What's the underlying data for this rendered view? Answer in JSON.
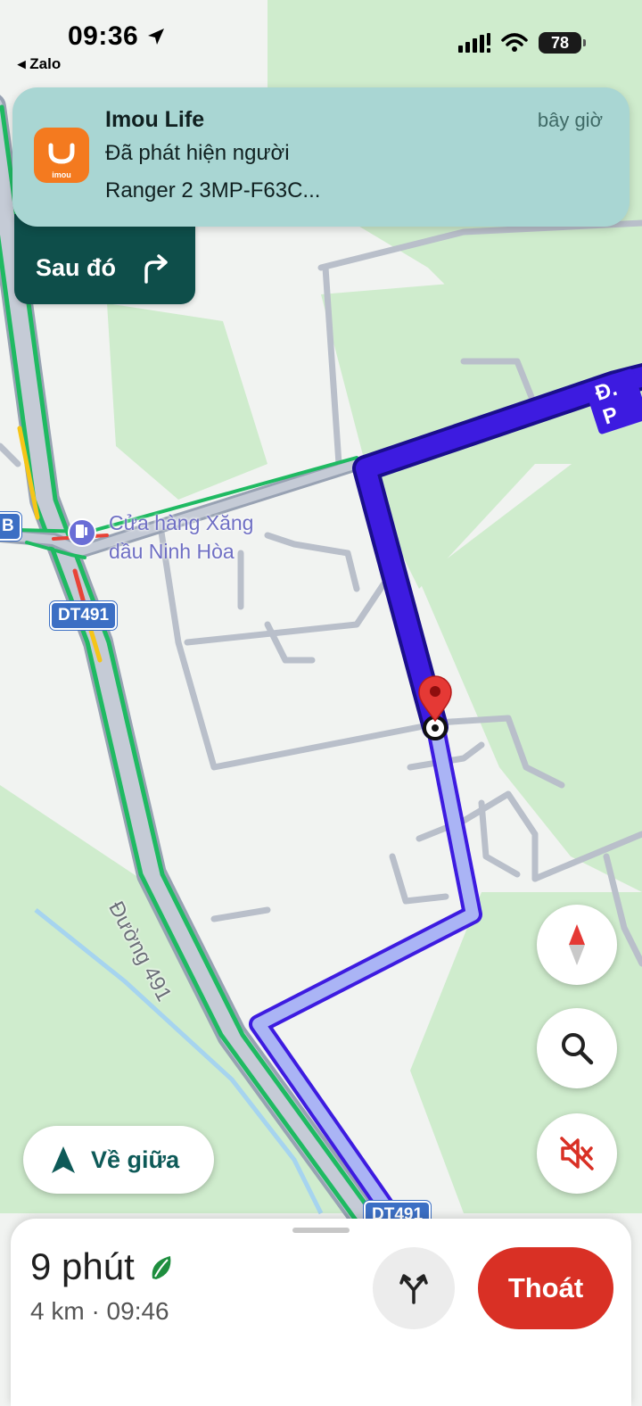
{
  "status_bar": {
    "time": "09:36",
    "back_app": "◂ Zalo",
    "battery": "78"
  },
  "notification": {
    "app_name": "Imou Life",
    "time": "bây giờ",
    "line1": "Đã phát hiện người",
    "line2": "Ranger 2 3MP-F63C...",
    "icon_label": "imou"
  },
  "next_turn": {
    "label": "Sau đó"
  },
  "map": {
    "poi_name_line1": "Cửa hàng Xăng",
    "poi_name_line2": "dầu Ninh Hòa",
    "road_shield_1": "DT491",
    "road_shield_2": "DT491",
    "road_name": "Đường 491",
    "top_road_name": "Đ. P",
    "edge_label": "B"
  },
  "controls": {
    "recenter_label": "Về giữa"
  },
  "trip": {
    "duration": "9 phút",
    "distance_eta": "4 km · 09:46",
    "exit_label": "Thoát"
  },
  "colors": {
    "route_active": "#3d1be0",
    "route_upcoming": "#aab4f5",
    "exit_button": "#d93025",
    "map_green": "#cfeccd",
    "next_turn_bg": "#0e4e4a"
  }
}
